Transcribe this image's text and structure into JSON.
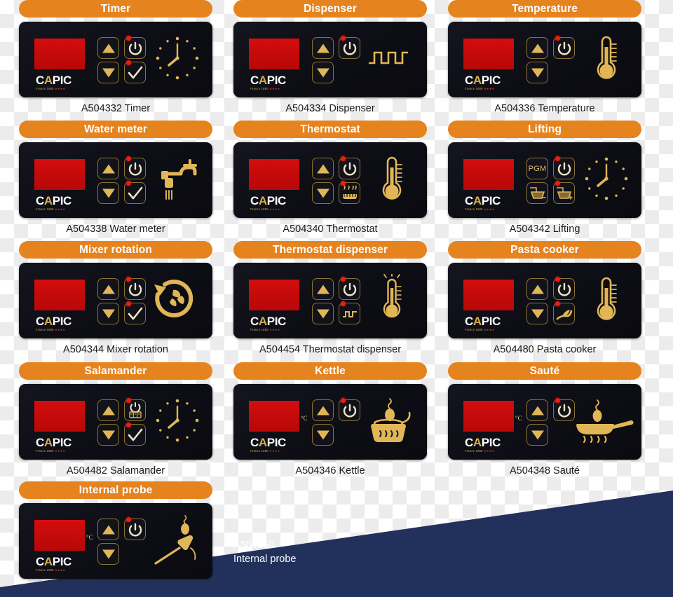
{
  "colors": {
    "header_orange": "#e5831f",
    "panel_black": "#12121b",
    "display_red": "#cc0b0b",
    "gold": "#e0b657",
    "led_red": "#e81f10",
    "navy": "#22305c",
    "caption_text": "#1b1b1b"
  },
  "brand": {
    "logo_c": "C",
    "logo_a": "A",
    "logo_pic": "PIC",
    "logo_sub": "France 1880",
    "logo_stars": "★★★★"
  },
  "navy_caption": {
    "code": "A504350",
    "name": "Internal probe"
  },
  "cards": [
    {
      "title": "Timer",
      "code": "A504332",
      "caption": "A504332 Timer",
      "degree_label": "",
      "keys": {
        "up": true,
        "down": true,
        "power": true,
        "second": "check"
      },
      "illustration": "clock-icon"
    },
    {
      "title": "Dispenser",
      "code": "A504334",
      "caption": "A504334 Dispenser",
      "degree_label": "",
      "keys": {
        "up": true,
        "down": true,
        "power": true,
        "second": "none"
      },
      "illustration": "square-wave-icon"
    },
    {
      "title": "Temperature",
      "code": "A504336",
      "caption": "A504336 Temperature",
      "degree_label": "",
      "keys": {
        "up": true,
        "down": true,
        "power": true,
        "second": "none"
      },
      "illustration": "thermometer-icon"
    },
    {
      "title": "Water meter",
      "code": "A504338",
      "caption": "A504338 Water meter",
      "degree_label": "",
      "keys": {
        "up": true,
        "down": true,
        "power": true,
        "second": "check"
      },
      "illustration": "faucet-icon"
    },
    {
      "title": "Thermostat",
      "code": "A504340",
      "caption": "A504340 Thermostat",
      "degree_label": "",
      "keys": {
        "up": true,
        "down": true,
        "power": true,
        "second": "heating-element"
      },
      "illustration": "thermometer-icon"
    },
    {
      "title": "Lifting",
      "code": "A504342",
      "caption": "A504342 Lifting",
      "degree_label": "",
      "keys": {
        "up": "pgm",
        "down": "basket-down",
        "power": true,
        "second": "basket-up"
      },
      "pgm_label": "PGM",
      "illustration": "clock-icon"
    },
    {
      "title": "Mixer rotation",
      "code": "A504344",
      "caption": "A504344 Mixer rotation",
      "degree_label": "",
      "keys": {
        "up": true,
        "down": true,
        "power": true,
        "second": "check"
      },
      "illustration": "mixer-rotation-icon"
    },
    {
      "title": "Thermostat dispenser",
      "code": "A504454",
      "caption": "A504454 Thermostat dispenser",
      "degree_label": "",
      "keys": {
        "up": true,
        "down": true,
        "power": true,
        "second": "wave-key"
      },
      "illustration": "thermometer-wave-icon"
    },
    {
      "title": "Pasta cooker",
      "code": "A504480",
      "caption": "A504480 Pasta cooker",
      "degree_label": "",
      "keys": {
        "up": true,
        "down": true,
        "power": true,
        "second": "pasta-icon"
      },
      "illustration": "thermometer-icon"
    },
    {
      "title": "Salamander",
      "code": "A504482",
      "caption": "A504482 Salamander",
      "degree_label": "",
      "keys": {
        "up": true,
        "down": true,
        "power": "power-timer",
        "second": "check"
      },
      "illustration": "clock-icon"
    },
    {
      "title": "Kettle",
      "code": "A504346",
      "caption": "A504346 Kettle",
      "degree_label": "°C",
      "keys": {
        "up": true,
        "down": true,
        "power": true,
        "second": "none"
      },
      "illustration": "kettle-icon"
    },
    {
      "title": "Sauté",
      "code": "A504348",
      "caption": "A504348 Sauté",
      "degree_label": "°C",
      "keys": {
        "up": true,
        "down": true,
        "power": true,
        "second": "none"
      },
      "illustration": "saute-pan-icon"
    },
    {
      "title": "Internal probe",
      "code": "A504350",
      "caption": "",
      "degree_label": "°C",
      "keys": {
        "up": true,
        "down": true,
        "power": true,
        "second": "none"
      },
      "illustration": "probe-icon"
    }
  ]
}
